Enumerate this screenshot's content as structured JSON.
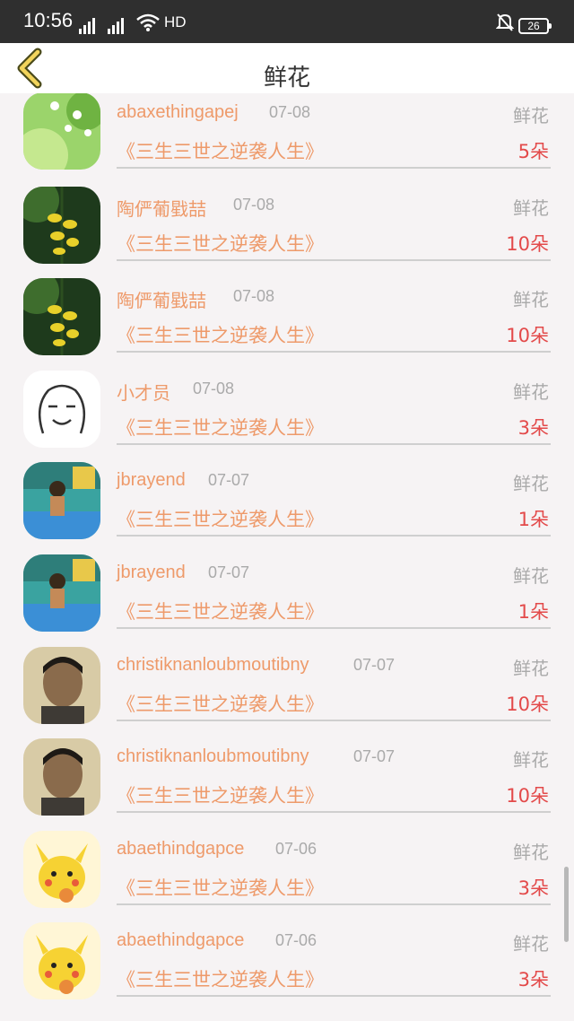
{
  "status_bar": {
    "time": "10:56",
    "network": "2G 4G",
    "wifi_label": "HD",
    "battery": "26"
  },
  "header": {
    "title": "鲜花"
  },
  "items": [
    {
      "name": "abaxethingapej",
      "date": "07-08",
      "type": "鲜花",
      "book": "《三生三世之逆袭人生》",
      "count": "5朵",
      "avatar": "flower-avatar"
    },
    {
      "name": "陶俨葡戥喆",
      "date": "07-08",
      "type": "鲜花",
      "book": "《三生三世之逆袭人生》",
      "count": "10朵",
      "avatar": "yellow-flowers-avatar"
    },
    {
      "name": "陶俨葡戥喆",
      "date": "07-08",
      "type": "鲜花",
      "book": "《三生三世之逆袭人生》",
      "count": "10朵",
      "avatar": "yellow-flowers-avatar"
    },
    {
      "name": "小才员",
      "date": "07-08",
      "type": "鲜花",
      "book": "《三生三世之逆袭人生》",
      "count": "3朵",
      "avatar": "sketch-face-avatar"
    },
    {
      "name": "jbrayend",
      "date": "07-07",
      "type": "鲜花",
      "book": "《三生三世之逆袭人生》",
      "count": "1朵",
      "avatar": "room-avatar"
    },
    {
      "name": "jbrayend",
      "date": "07-07",
      "type": "鲜花",
      "book": "《三生三世之逆袭人生》",
      "count": "1朵",
      "avatar": "room-avatar"
    },
    {
      "name": "christiknanloubmoutibny",
      "date": "07-07",
      "type": "鲜花",
      "book": "《三生三世之逆袭人生》",
      "count": "10朵",
      "avatar": "portrait-avatar"
    },
    {
      "name": "christiknanloubmoutibny",
      "date": "07-07",
      "type": "鲜花",
      "book": "《三生三世之逆袭人生》",
      "count": "10朵",
      "avatar": "portrait-avatar"
    },
    {
      "name": "abaethindgapce",
      "date": "07-06",
      "type": "鲜花",
      "book": "《三生三世之逆袭人生》",
      "count": "3朵",
      "avatar": "pikachu-avatar"
    },
    {
      "name": "abaethindgapce",
      "date": "07-06",
      "type": "鲜花",
      "book": "《三生三世之逆袭人生》",
      "count": "3朵",
      "avatar": "pikachu-avatar"
    }
  ]
}
